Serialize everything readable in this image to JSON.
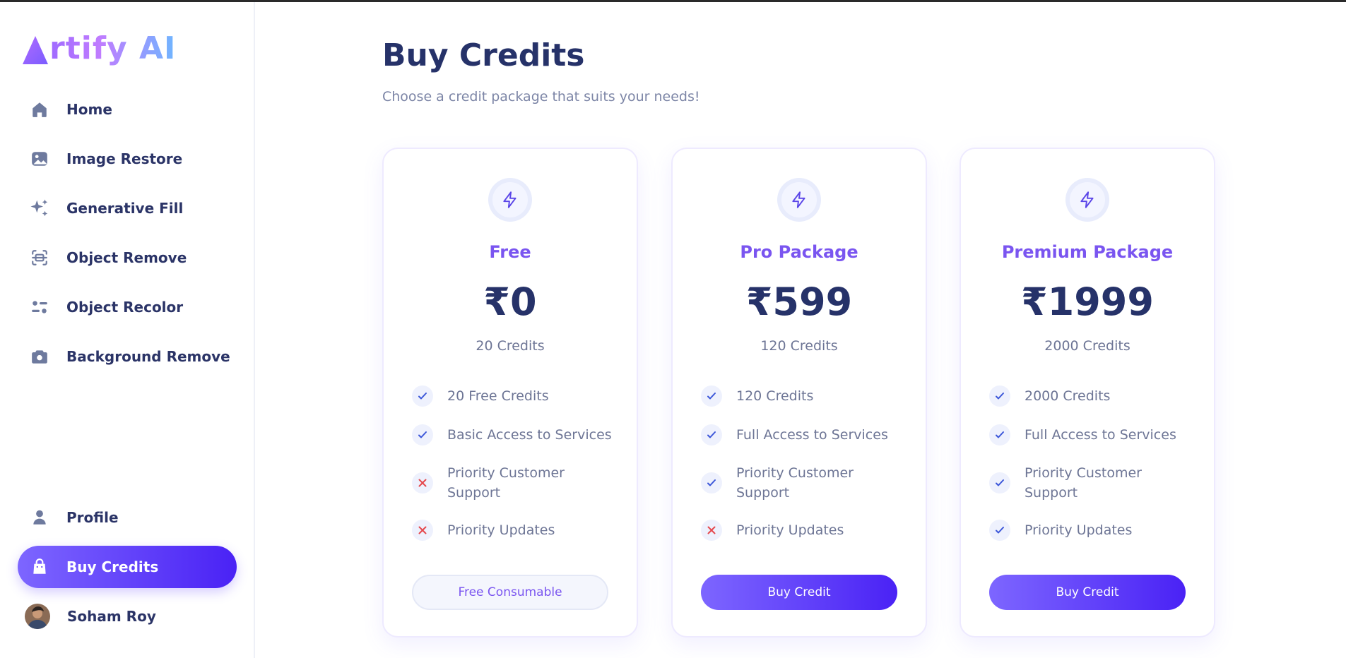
{
  "app": {
    "logo_text": "rtify AI",
    "logo_full": "Artify AI"
  },
  "sidebar": {
    "main_items": [
      {
        "label": "Home",
        "icon": "home-icon"
      },
      {
        "label": "Image Restore",
        "icon": "image-icon"
      },
      {
        "label": "Generative Fill",
        "icon": "sparkles-icon"
      },
      {
        "label": "Object Remove",
        "icon": "scan-icon"
      },
      {
        "label": "Object Recolor",
        "icon": "filter-icon"
      },
      {
        "label": "Background Remove",
        "icon": "camera-icon"
      }
    ],
    "bottom_items": [
      {
        "label": "Profile",
        "icon": "user-icon"
      },
      {
        "label": "Buy Credits",
        "icon": "bag-icon",
        "active": true
      }
    ],
    "user": {
      "name": "Soham Roy"
    }
  },
  "main": {
    "title": "Buy Credits",
    "subtitle": "Choose a credit package that suits your needs!"
  },
  "plans": [
    {
      "name": "Free",
      "price": "₹0",
      "credits": "20 Credits",
      "features": [
        {
          "text": "20 Free Credits",
          "included": true
        },
        {
          "text": "Basic Access to Services",
          "included": true
        },
        {
          "text": "Priority Customer Support",
          "included": false
        },
        {
          "text": "Priority Updates",
          "included": false
        }
      ],
      "button": "Free Consumable"
    },
    {
      "name": "Pro Package",
      "price": "₹599",
      "credits": "120 Credits",
      "features": [
        {
          "text": "120 Credits",
          "included": true
        },
        {
          "text": "Full Access to Services",
          "included": true
        },
        {
          "text": "Priority Customer Support",
          "included": true
        },
        {
          "text": "Priority Updates",
          "included": false
        }
      ],
      "button": "Buy Credit"
    },
    {
      "name": "Premium Package",
      "price": "₹1999",
      "credits": "2000 Credits",
      "features": [
        {
          "text": "2000 Credits",
          "included": true
        },
        {
          "text": "Full Access to Services",
          "included": true
        },
        {
          "text": "Priority Customer Support",
          "included": true
        },
        {
          "text": "Priority Updates",
          "included": true
        }
      ],
      "button": "Buy Credit"
    }
  ],
  "colors": {
    "accent": "#6a4dff",
    "title": "#263269",
    "muted": "#6d7595",
    "check": "#3b56d9",
    "cross": "#e5484d"
  }
}
